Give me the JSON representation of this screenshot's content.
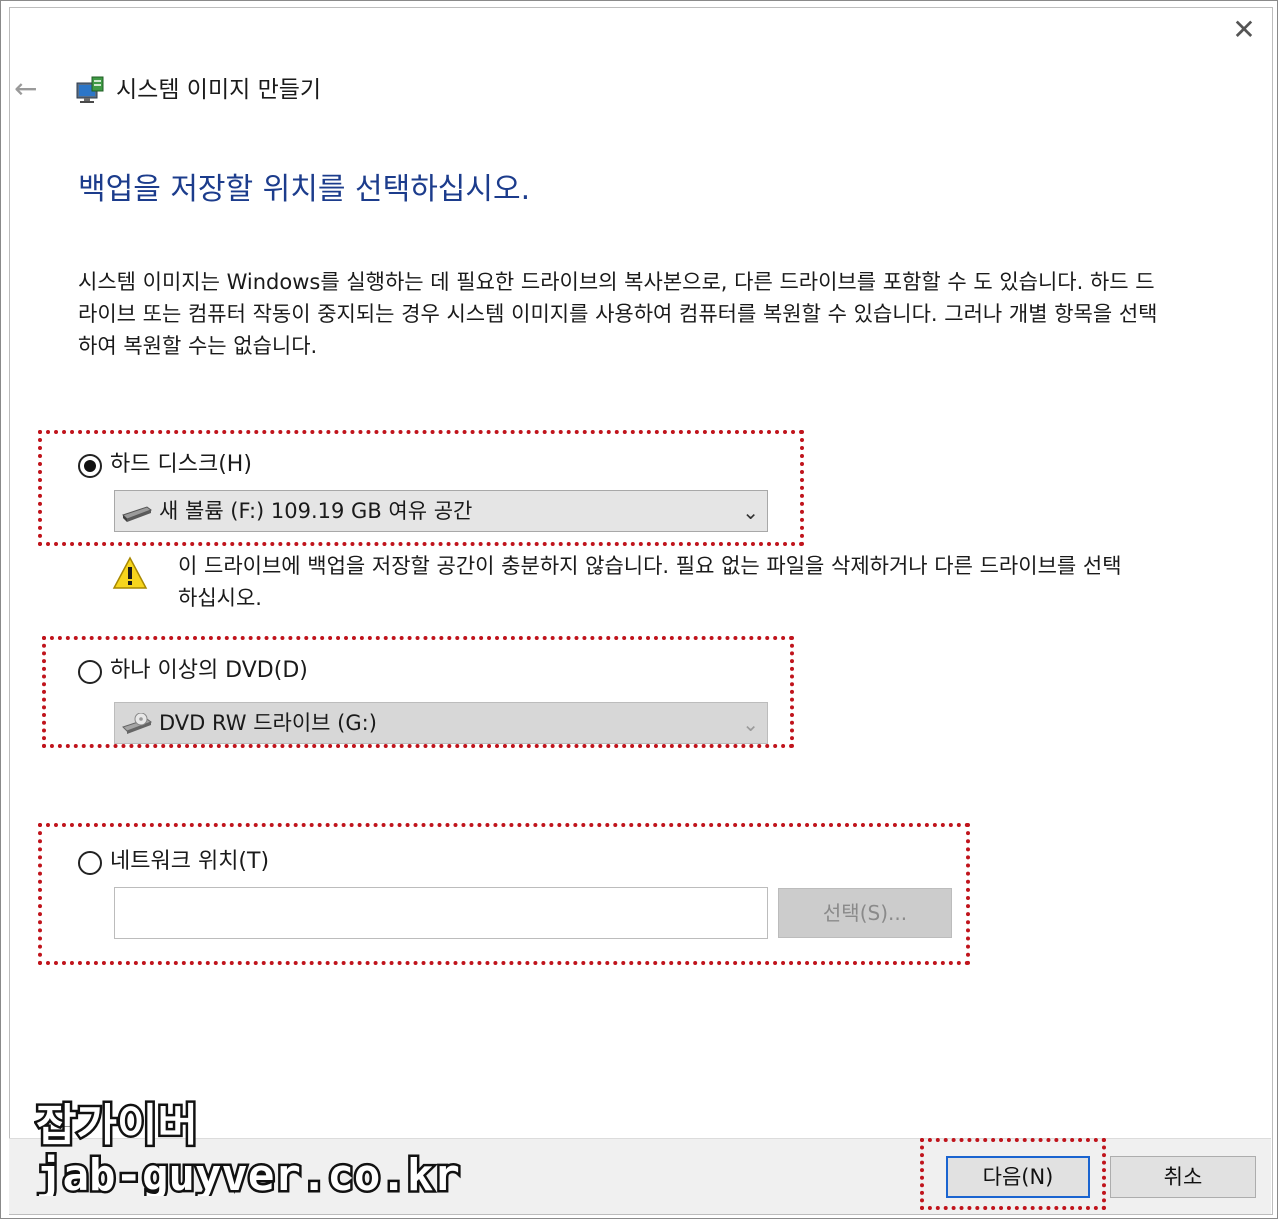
{
  "window": {
    "title": "시스템 이미지 만들기",
    "close_glyph": "✕",
    "back_glyph": "←"
  },
  "page": {
    "heading": "백업을 저장할 위치를 선택하십시오.",
    "description": "시스템 이미지는 Windows를 실행하는 데 필요한 드라이브의 복사본으로, 다른 드라이브를 포함할 수 도 있습니다. 하드 드라이브 또는 컴퓨터 작동이 중지되는 경우 시스템 이미지를 사용하여 컴퓨터를 복원할 수 있습니다. 그러나 개별 항목을 선택하여 복원할 수는 없습니다."
  },
  "options": {
    "hard_disk": {
      "label": "하드 디스크(H)",
      "selected": true,
      "dropdown_value": "새 볼륨 (F:)  109.19 GB 여유 공간",
      "warning": "이 드라이브에 백업을 저장할 공간이 충분하지 않습니다. 필요 없는 파일을 삭제하거나 다른 드라이브를 선택하십시오."
    },
    "dvd": {
      "label": "하나 이상의 DVD(D)",
      "selected": false,
      "dropdown_value": "DVD RW 드라이브 (G:)"
    },
    "network": {
      "label": "네트워크 위치(T)",
      "selected": false,
      "input_value": "",
      "select_button": "선택(S)..."
    }
  },
  "footer": {
    "next_button": "다음(N)",
    "cancel_button": "취소"
  },
  "watermark": {
    "line1": "잡가이버",
    "line2": "jab-guyver.co.kr"
  },
  "colors": {
    "heading": "#1c3c8c",
    "highlight_dots": "#c0141c",
    "primary_border": "#1a64d0"
  }
}
